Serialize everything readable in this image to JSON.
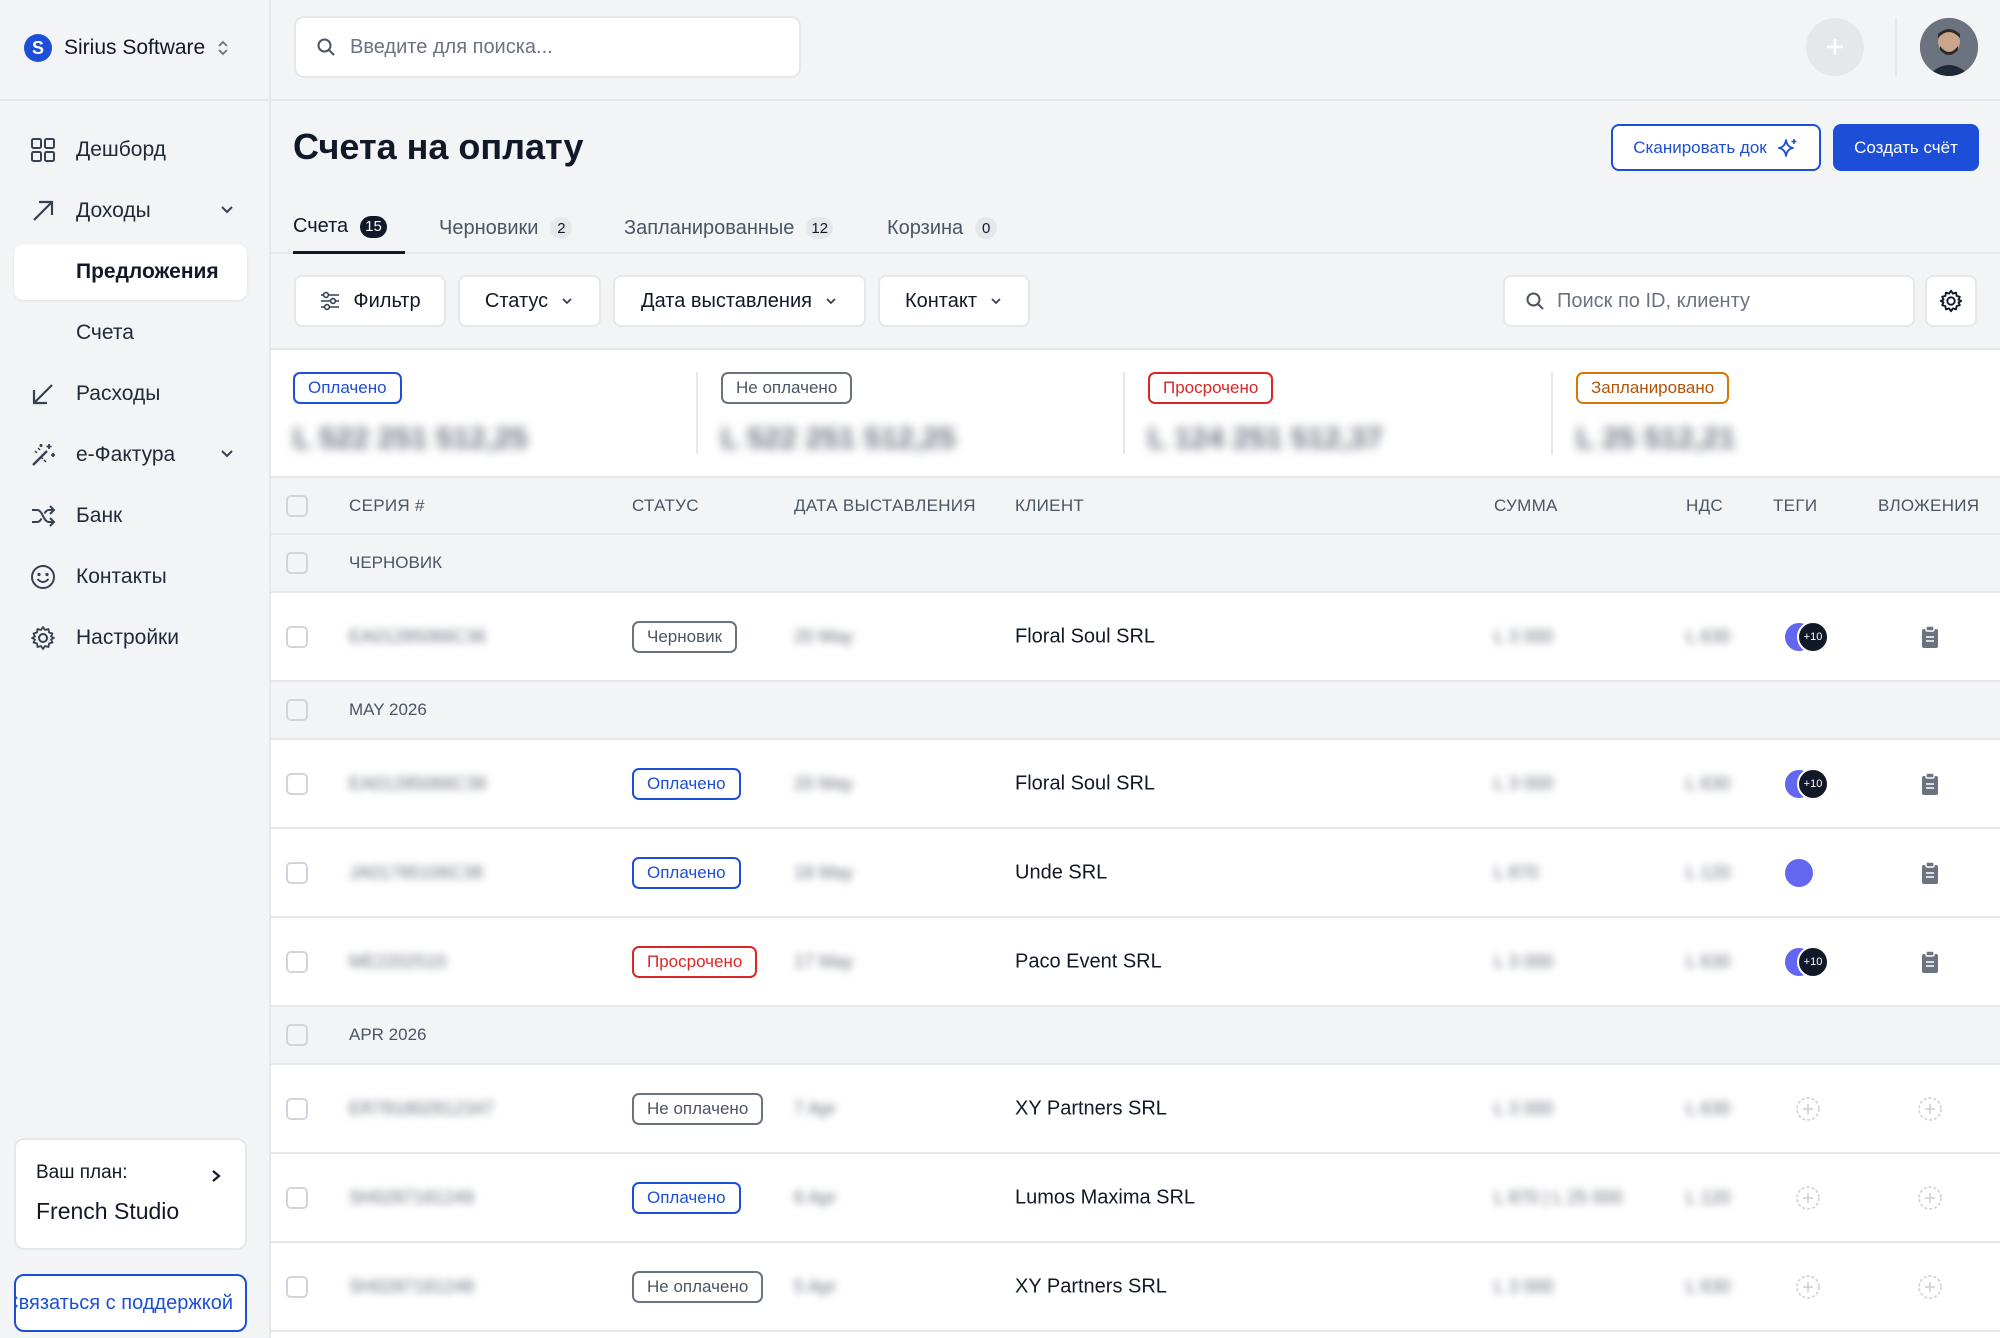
{
  "brand": {
    "name": "Sirius Software",
    "logo_letter": "S"
  },
  "sidebar": {
    "items": [
      {
        "label": "Дешборд",
        "icon": "grid-icon"
      },
      {
        "label": "Доходы",
        "icon": "arrow-up-right-icon"
      },
      {
        "label": "Предложения"
      },
      {
        "label": "Счета"
      },
      {
        "label": "Расходы",
        "icon": "arrow-down-left-icon"
      },
      {
        "label": "e-Фактура",
        "icon": "magic-wand-icon"
      },
      {
        "label": "Банк",
        "icon": "shuffle-icon"
      },
      {
        "label": "Контакты",
        "icon": "smile-icon"
      },
      {
        "label": "Настройки",
        "icon": "gear-icon"
      }
    ],
    "plan": {
      "label": "Ваш план:",
      "name": "French Studio"
    },
    "support_label": "Связаться с поддержкой"
  },
  "topbar": {
    "search_placeholder": "Введите для поиска..."
  },
  "page": {
    "title": "Счета на оплату",
    "scan_label": "Сканировать док",
    "create_label": "Создать счёт"
  },
  "tabs": [
    {
      "label": "Счета",
      "count": "15"
    },
    {
      "label": "Черновики",
      "count": "2"
    },
    {
      "label": "Запланированные",
      "count": "12"
    },
    {
      "label": "Корзина",
      "count": "0"
    }
  ],
  "filters": {
    "filter_label": "Фильтр",
    "status_label": "Статус",
    "date_label": "Дата выставления",
    "contact_label": "Контакт",
    "id_search_placeholder": "Поиск по ID, клиенту"
  },
  "summary": [
    {
      "label": "Оплачено",
      "amount": "L 522 251 512,25"
    },
    {
      "label": "Не оплачено",
      "amount": "L 522 251 512,25"
    },
    {
      "label": "Просрочено",
      "amount": "L 124 251 512,37"
    },
    {
      "label": "Запланировано",
      "amount": "L 25 512,21"
    }
  ],
  "table": {
    "columns": [
      "СЕРИЯ #",
      "СТАТУС",
      "ДАТА ВЫСТАВЛЕНИЯ",
      "КЛИЕНТ",
      "СУММА",
      "НДС",
      "ТЕГИ",
      "ВЛОЖЕНИЯ"
    ],
    "groups": [
      "ЧЕРНОВИК",
      "MAY 2026",
      "APR 2026"
    ],
    "rows": [
      {
        "series": "EA01285066C36",
        "status": "Черновик",
        "date": "20 May",
        "client": "Floral Soul SRL",
        "amount": "L 3 000",
        "vat": "L 630",
        "tags_more": "+10"
      },
      {
        "series": "EA01285066C38",
        "status": "Оплачено",
        "date": "20 May",
        "client": "Floral Soul SRL",
        "amount": "L 3 000",
        "vat": "L 630",
        "tags_more": "+10"
      },
      {
        "series": "JA01785106C38",
        "status": "Оплачено",
        "date": "18 May",
        "client": "Unde SRL",
        "amount": "L 870",
        "vat": "L 120"
      },
      {
        "series": "ME2202510",
        "status": "Просрочено",
        "date": "17 May",
        "client": "Paco Event SRL",
        "amount": "L 3 000",
        "vat": "L 630",
        "tags_more": "+10"
      },
      {
        "series": "ER781802812347",
        "status": "Не оплачено",
        "date": "7 Apr",
        "client": "XY Partners SRL",
        "amount": "L 3 000",
        "vat": "L 630"
      },
      {
        "series": "SH0287181249",
        "status": "Оплачено",
        "date": "6 Apr",
        "client": "Lumos Maxima SRL",
        "amount": "L 870 | L 25 000",
        "vat": "L 120"
      },
      {
        "series": "SH0287181248",
        "status": "Не оплачено",
        "date": "5 Apr",
        "client": "XY Partners SRL",
        "amount": "L 3 000",
        "vat": "L 630"
      }
    ]
  },
  "colors": {
    "accent": "#1d4ed8",
    "paid": "#1d4ed8",
    "overdue": "#dc2626",
    "scheduled": "#d97706",
    "tag": "#6366f1"
  }
}
